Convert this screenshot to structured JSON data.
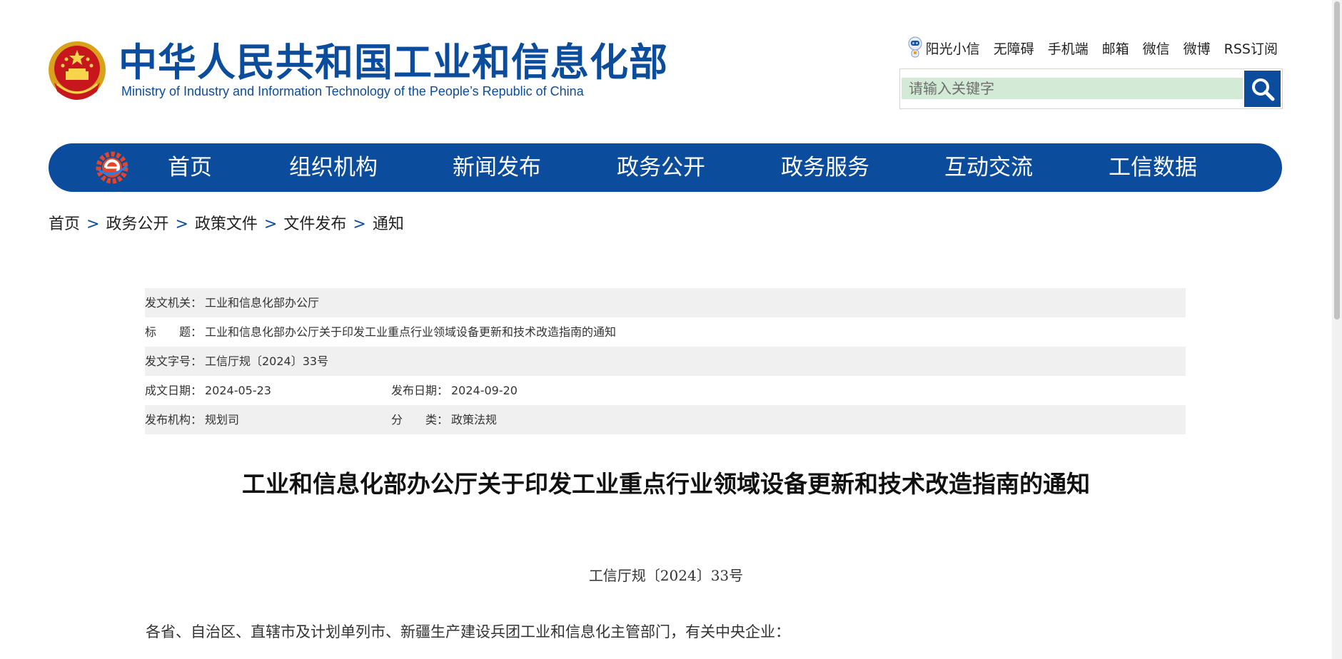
{
  "header": {
    "logo_cn": "中华人民共和国工业和信息化部",
    "logo_en": "Ministry of Industry and Information Technology of the People’s Republic of China",
    "top_links": [
      "阳光小信",
      "无障碍",
      "手机端",
      "邮箱",
      "微信",
      "微博",
      "RSS订阅"
    ],
    "search_placeholder": "请输入关键字",
    "search_icon": "search-icon",
    "robot_icon": "robot-mascot-icon",
    "emblem_icon": "national-emblem-icon"
  },
  "nav": {
    "logo_icon": "miit-gear-logo-icon",
    "items": [
      "首页",
      "组织机构",
      "新闻发布",
      "政务公开",
      "政务服务",
      "互动交流",
      "工信数据"
    ]
  },
  "breadcrumb": {
    "items": [
      "首页",
      "政务公开",
      "政策文件",
      "文件发布",
      "通知"
    ],
    "separator": ">"
  },
  "info": {
    "issuer_label": "发文机关：",
    "issuer": "工业和信息化部办公厅",
    "title_label": "标　　题：",
    "title": "工业和信息化部办公厅关于印发工业重点行业领域设备更新和技术改造指南的通知",
    "doc_no_label": "发文字号：",
    "doc_no": "工信厅规〔2024〕33号",
    "created_label": "成文日期：",
    "created": "2024-05-23",
    "published_label": "发布日期：",
    "published": "2024-09-20",
    "org_label": "发布机构：",
    "org": "规划司",
    "category_label": "分　　类：",
    "category": "政策法规"
  },
  "article": {
    "title": "工业和信息化部办公厅关于印发工业重点行业领域设备更新和技术改造指南的通知",
    "doc_number": "工信厅规〔2024〕33号",
    "salutation": "各省、自治区、直辖市及计划单列市、新疆生产建设兵团工业和信息化主管部门，有关中央企业："
  },
  "colors": {
    "brand_blue": "#0b4c9c",
    "search_bg": "#d3ebd6",
    "row_shade": "#f0f0f0"
  }
}
